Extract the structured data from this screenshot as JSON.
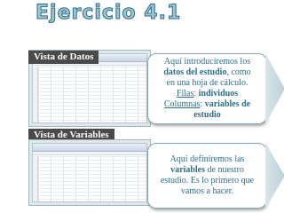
{
  "title": "Ejercicio 4.1",
  "sections": [
    {
      "label": "Vista de Datos",
      "text": {
        "l1": "Aquí introduciremos los",
        "l2_bold": "datos del estudio",
        "l2_rest": ", como",
        "l3": "en una hoja de cálculo.",
        "l4_u": "Filas",
        "l4_sep": ": ",
        "l4_bold": "individuos",
        "l5_u": "Columnas",
        "l5_sep": ": ",
        "l5_bold": "variables de",
        "l6_bold": "estudio"
      }
    },
    {
      "label": "Vista de Variables",
      "text": {
        "l1": "Aquí definiremos las",
        "l2_bold": "variables",
        "l2_rest": " de  nuestro",
        "l3": "estudio. Es lo primero que",
        "l4": "vamos a hacer."
      }
    }
  ],
  "colors": {
    "accent": "#2f6f86",
    "title_fill": "#9ec4d2",
    "label_bg": "#4a4a4a"
  }
}
